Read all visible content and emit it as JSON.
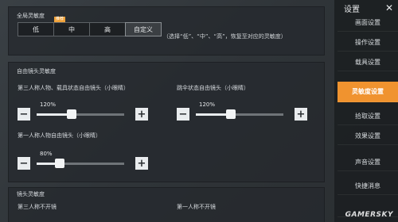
{
  "global_sensitivity": {
    "title": "全局灵敏度",
    "presets": [
      {
        "label": "低"
      },
      {
        "label": "中",
        "badge": "推荐"
      },
      {
        "label": "高"
      },
      {
        "label": "自定义"
      }
    ],
    "hint": "（选择“低”、“中”、“高”，恢复至对应的灵敏度）"
  },
  "free_look": {
    "title": "自由镜头灵敏度",
    "sliders": [
      {
        "label": "第三人称人物、载具状态自由镜头（小眼睛）",
        "value_text": "120%",
        "value": 120
      },
      {
        "label": "跳伞状态自由镜头（小眼睛）",
        "value_text": "120%",
        "value": 120
      },
      {
        "label": "第一人称人物自由镜头（小眼睛）",
        "value_text": "80%",
        "value": 80
      }
    ]
  },
  "lens_sensitivity": {
    "title": "镜头灵敏度",
    "third_person": "第三人称不开镜",
    "first_person": "第一人称不开镜"
  },
  "sidebar": {
    "title": "设置",
    "close_glyph": "✕",
    "items": [
      {
        "label": "画面设置"
      },
      {
        "label": "操作设置"
      },
      {
        "label": "载具设置"
      },
      {
        "label": "灵敏度设置",
        "active": true
      },
      {
        "label": "拾取设置"
      },
      {
        "label": "效果设置"
      },
      {
        "label": "声音设置"
      },
      {
        "label": "快捷消息"
      },
      {
        "label": ""
      }
    ]
  },
  "watermark": "GAMERSKY",
  "colors": {
    "accent": "#f0932f",
    "badge": "#f0a23a"
  }
}
